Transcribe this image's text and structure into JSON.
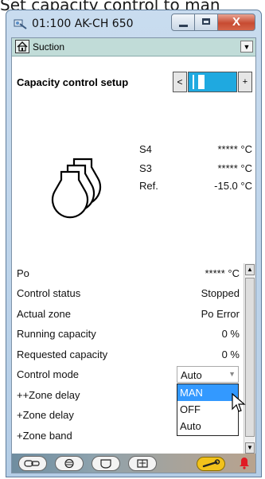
{
  "caption": "Set capacity control to man",
  "window": {
    "title": "01:100 AK-CH 650",
    "close_glyph": "X"
  },
  "nav": {
    "label": "Suction",
    "dropdown_glyph": "▼"
  },
  "capacity_control": {
    "title": "Capacity control setup",
    "left_glyph": "<",
    "right_glyph": "+"
  },
  "measurements": [
    {
      "label": "S4",
      "value": "***** °C"
    },
    {
      "label": "S3",
      "value": "***** °C"
    },
    {
      "label": "Ref.",
      "value": "-15.0 °C"
    }
  ],
  "parameters": [
    {
      "label": "Po",
      "value": "***** °C"
    },
    {
      "label": "Control status",
      "value": "Stopped"
    },
    {
      "label": "Actual zone",
      "value": "Po Error"
    },
    {
      "label": "Running capacity",
      "value": "0 %"
    },
    {
      "label": "Requested capacity",
      "value": "0 %"
    },
    {
      "label": "Control mode",
      "value": ""
    },
    {
      "label": "++Zone delay",
      "value": ""
    },
    {
      "label": "+Zone delay",
      "value": ""
    },
    {
      "label": "+Zone band",
      "value": ""
    }
  ],
  "control_mode_select": {
    "selected": "Auto",
    "arrow": "▼",
    "options": [
      "MAN",
      "OFF",
      "Auto"
    ],
    "highlighted_option": "MAN"
  },
  "scrollbar": {
    "up": "▲",
    "down": "▼"
  },
  "bottom_tabs": [
    "tab-1",
    "tab-2",
    "tab-3",
    "tab-4"
  ],
  "colors": {
    "nav_bar": "#c1dcd8",
    "capacity_bar": "#1fa9e0",
    "highlight": "#3399ff",
    "wrench": "#f2c21b",
    "alarm": "#e01b24"
  }
}
